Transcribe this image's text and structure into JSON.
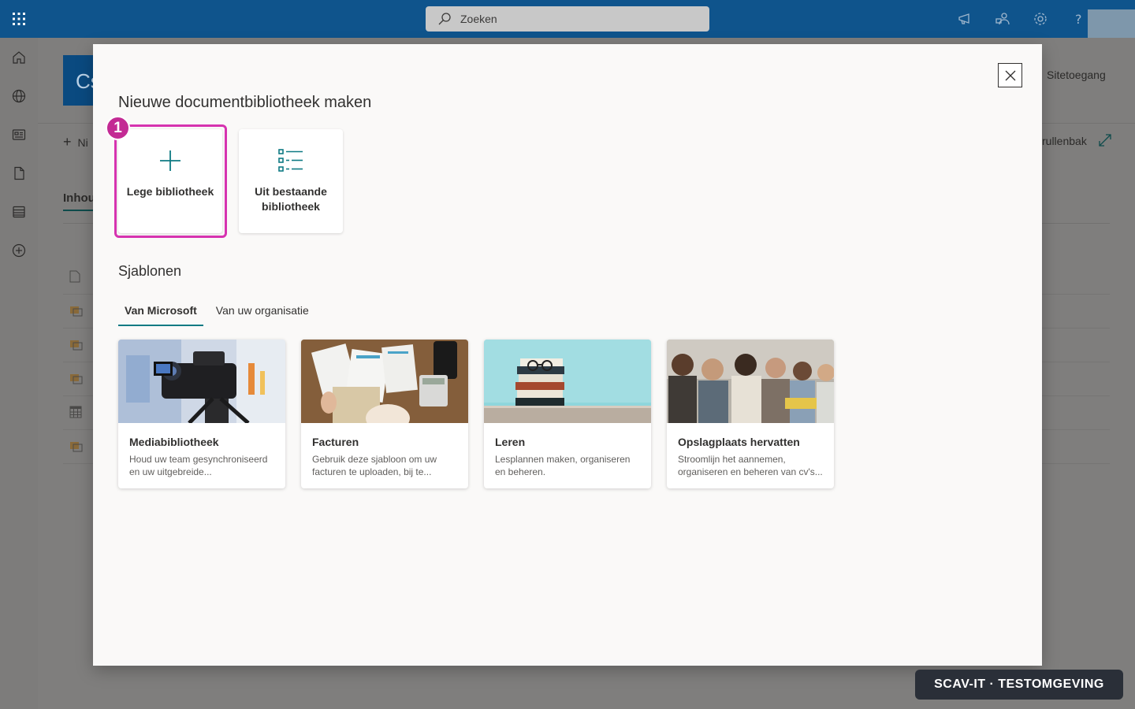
{
  "suitebar": {
    "search_placeholder": "Zoeken",
    "icons": [
      "waffle-icon",
      "megaphone-icon",
      "share-people-icon",
      "gear-icon",
      "help-icon"
    ]
  },
  "background_page": {
    "site_logo_text": "Cs",
    "new_command": "Ni",
    "tab_label": "Inhou",
    "site_access": "Sitetoegang",
    "recycle_bin": "rullenbak"
  },
  "dialog": {
    "title": "Nieuwe documentbibliotheek maken",
    "options": [
      {
        "label": "Lege bibliotheek",
        "icon": "plus-icon"
      },
      {
        "label": "Uit bestaande bibliotheek",
        "icon": "list-icon"
      }
    ],
    "step_badge": "1",
    "templates_heading": "Sjablonen",
    "tabs": [
      {
        "label": "Van Microsoft",
        "active": true
      },
      {
        "label": "Van uw organisatie",
        "active": false
      }
    ],
    "templates": [
      {
        "name": "Mediabibliotheek",
        "description": "Houd uw team gesynchroniseerd en uw uitgebreide..."
      },
      {
        "name": "Facturen",
        "description": "Gebruik deze sjabloon om uw facturen te uploaden, bij te..."
      },
      {
        "name": "Leren",
        "description": "Lesplannen maken, organiseren en beheren."
      },
      {
        "name": "Opslagplaats hervatten",
        "description": "Stroomlijn het aannemen, organiseren en beheren van cv's..."
      }
    ]
  },
  "watermark": "SCAV-IT  ·  TESTOMGEVING",
  "colors": {
    "suitebar": "#0f548c",
    "accent": "#0e7a83",
    "highlight": "#d633b0"
  }
}
